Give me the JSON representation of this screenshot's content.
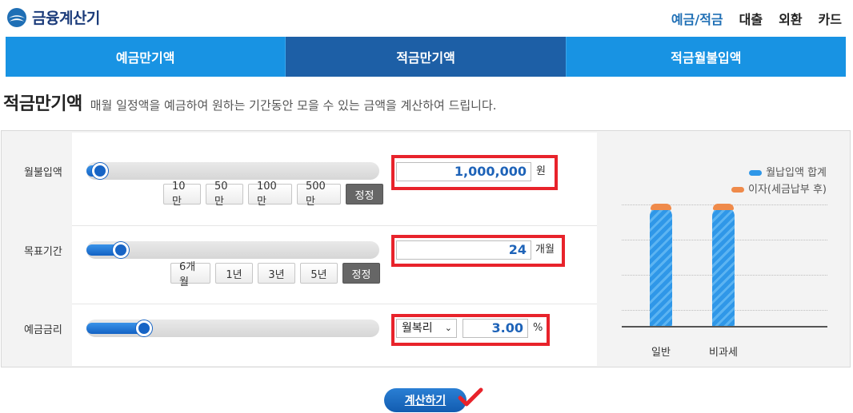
{
  "header": {
    "logo_text": "금융계산기",
    "nav": [
      "예금/적금",
      "대출",
      "외환",
      "카드"
    ]
  },
  "tabs": [
    "예금만기액",
    "적금만기액",
    "적금월불입액"
  ],
  "title": {
    "main": "적금만기액",
    "description": "매월 일정액을 예금하여 원하는 기간동안 모을 수 있는 금액을 계산하여 드립니다."
  },
  "monthly_payment": {
    "label": "월불입액",
    "slider_value": 0.02,
    "chips": [
      "10만",
      "50만",
      "100만",
      "500만",
      "정정"
    ],
    "value": "1,000,000",
    "unit": "원"
  },
  "target_period": {
    "label": "목표기간",
    "slider_value": 0.09,
    "chips": [
      "6개월",
      "1년",
      "3년",
      "5년",
      "정정"
    ],
    "value": "24",
    "unit": "개월"
  },
  "interest_rate": {
    "label": "예금금리",
    "slider_value": 0.17,
    "method": "월복리",
    "value": "3.00",
    "unit": "%"
  },
  "chart": {
    "legend": [
      "월납입액 합계",
      "이자(세금납부 후)"
    ],
    "categories": [
      "일반",
      "비과세"
    ],
    "colors": {
      "principal": "#2f97e8",
      "interest": "#ef8a4a"
    }
  },
  "calculate_button": "계산하기",
  "colors": {
    "accent": "#1893e3",
    "active_tab": "#1d5fa6",
    "highlight": "#e8232b"
  }
}
